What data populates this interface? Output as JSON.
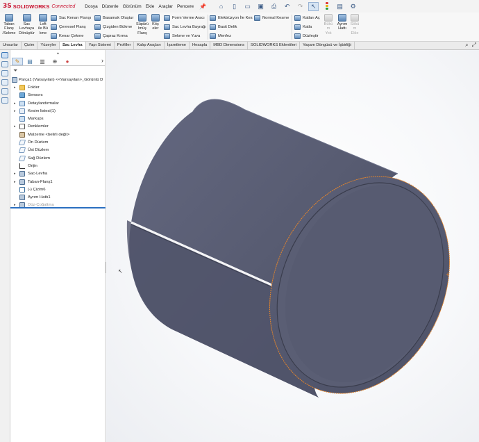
{
  "app": {
    "logo_ds": "3S",
    "logo_brand": "SOLIDWORKS",
    "logo_tag": "Connected",
    "menu": [
      "Dosya",
      "Düzenle",
      "Görünüm",
      "Ekle",
      "Araçlar",
      "Pencere"
    ],
    "pin_icon": "pin-icon"
  },
  "ribbon": {
    "big_buttons": [
      {
        "label": "Taban\nFlanş\n/Sekme",
        "enabled": true
      },
      {
        "label": "Sac\nLevhaya\nDönüştür",
        "enabled": true
      },
      {
        "label": "Loft\nile Bü\nkme",
        "enabled": true
      }
    ],
    "group1": [
      "Sac Kenarı Flanşı",
      "Çevresel Flanş",
      "Kenar Çekme"
    ],
    "group2": [
      "Basamak Oluştur",
      "Çizgiden Bükme",
      "Çapraz Kırma"
    ],
    "swept_flange": "Süpürü\nlmüş\nFlanş",
    "kose": "Köş\neler",
    "group3": [
      "Form Verme Aracı",
      "Sac Levha Bayrağı",
      "Sekme ve Yuva"
    ],
    "group4": [
      "Elektrüzyon İle Kes",
      "Basit Delik",
      "Menfez"
    ],
    "normal_kesme": "Normal Kesme",
    "group5": [
      "Katları Aç",
      "Katla",
      "Düzleştir"
    ],
    "right_buttons": [
      {
        "label": "Bükü\nm\nYok",
        "enabled": false
      },
      {
        "label": "Ayrım\nHattı",
        "enabled": true
      },
      {
        "label": "Sökü\nm\nEkle",
        "enabled": false
      }
    ]
  },
  "tabs": [
    "Unsurlar",
    "Çizim",
    "Yüzeyler",
    "Sac Levha",
    "Yapı Sistemi",
    "Profiller",
    "Kalıp Araçları",
    "İşaretleme",
    "Hesapla",
    "MBD Dimensions",
    "SOLIDWORKS Eklentileri",
    "Yaşam Döngüsü ve İşbirliği"
  ],
  "active_tab": "Sac Levha",
  "tree": {
    "root": "Parça1 (Varsayılan) <<Varsayılan>_Görüntü D",
    "items": [
      {
        "label": "Folder",
        "icon": "folder",
        "expand": "▸"
      },
      {
        "label": "Sensors",
        "icon": "sensor",
        "expand": ""
      },
      {
        "label": "Detaylandırmalar",
        "icon": "ann",
        "expand": "▸"
      },
      {
        "label": "Kesim listesi(1)",
        "icon": "cut",
        "expand": "▸"
      },
      {
        "label": "Markups",
        "icon": "ann",
        "expand": ""
      },
      {
        "label": "Denklemler",
        "icon": "eq",
        "expand": "▸"
      },
      {
        "label": "Malzeme <belirli değil>",
        "icon": "mat",
        "expand": ""
      },
      {
        "label": "Ön Düzlem",
        "icon": "plane",
        "expand": ""
      },
      {
        "label": "Üst Düzlem",
        "icon": "plane",
        "expand": ""
      },
      {
        "label": "Sağ Düzlem",
        "icon": "plane",
        "expand": ""
      },
      {
        "label": "Orijin",
        "icon": "origin",
        "expand": ""
      },
      {
        "label": "Sac-Levha",
        "icon": "feat",
        "expand": "▸"
      },
      {
        "label": "Taban-Flanş1",
        "icon": "feat",
        "expand": "▸"
      },
      {
        "label": "(-) Çizim6",
        "icon": "sketch",
        "expand": ""
      },
      {
        "label": "Ayrım Hattı1",
        "icon": "feat",
        "expand": ""
      },
      {
        "label": "Düz-Çoğaltma",
        "icon": "feat",
        "expand": "▸",
        "suppressed": true
      }
    ]
  },
  "colors": {
    "cylinder_body": "#5b5f73",
    "cylinder_dark": "#3f4254",
    "edge_highlight": "#e8862a",
    "accent": "#2a6fc0"
  }
}
